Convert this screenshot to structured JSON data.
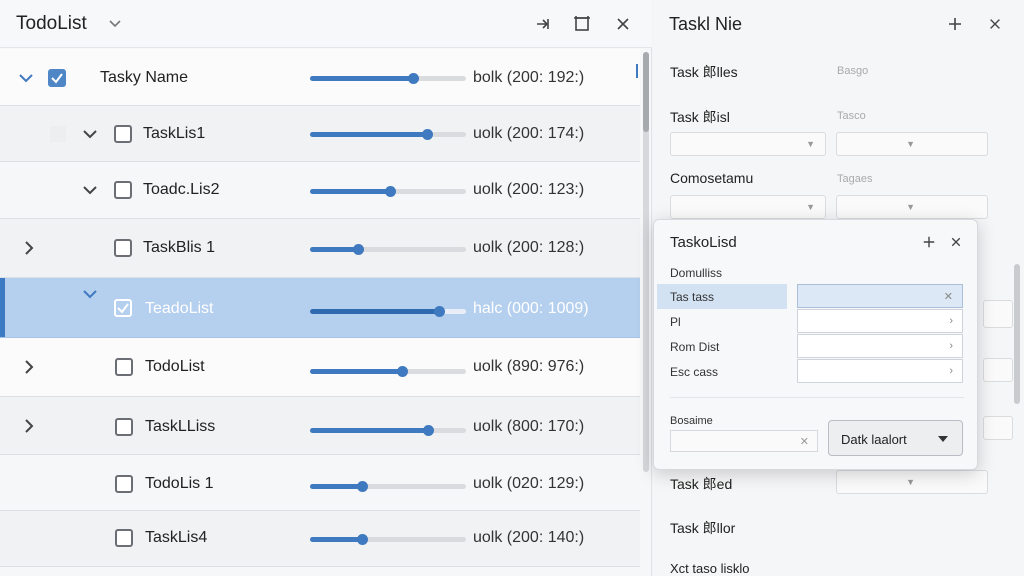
{
  "left": {
    "title": "TodoList",
    "rows": [
      {
        "label": "Tasky Name",
        "status": "bolk (200: 192:)",
        "progress": 0.66
      },
      {
        "label": "TaskLis1",
        "status": "uolk (200: 174:)",
        "progress": 0.75
      },
      {
        "label": "Toadc.Lis2",
        "status": "uolk (200: 123:)",
        "progress": 0.51
      },
      {
        "label": "TaskBlis 1",
        "status": "uolk (200: 128:)",
        "progress": 0.31
      },
      {
        "label": "TeadoList",
        "status": "halc (000: 1009)",
        "progress": 0.83
      },
      {
        "label": "TodoList",
        "status": "uolk (890: 976:)",
        "progress": 0.59
      },
      {
        "label": "TaskLLiss",
        "status": "uolk (800: 170:)",
        "progress": 0.76
      },
      {
        "label": "TodoLis 1",
        "status": "uolk (020: 129:)",
        "progress": 0.33
      },
      {
        "label": "TaskLis4",
        "status": "uolk (200: 140:)",
        "progress": 0.33
      }
    ]
  },
  "right": {
    "title": "Taskl Nie",
    "fields": [
      {
        "label": "Task 郎lles",
        "value": "Basgo"
      },
      {
        "label": "Task 郎isl",
        "value": "Tasco"
      },
      {
        "label": "Comosetamu",
        "value": "Tagaes"
      }
    ],
    "fields_bottom": [
      {
        "label": "Task 郎ed"
      },
      {
        "label": "Task 郎llor"
      },
      {
        "label": "Xct taso lisklo"
      }
    ]
  },
  "dialog": {
    "title": "TaskoLisd",
    "labels": [
      "Domulliss",
      "Tas tass",
      "Pl",
      "Rom Dist",
      "Esc cass"
    ],
    "section_label": "Bosaime",
    "button_label": "Datk laalort"
  }
}
